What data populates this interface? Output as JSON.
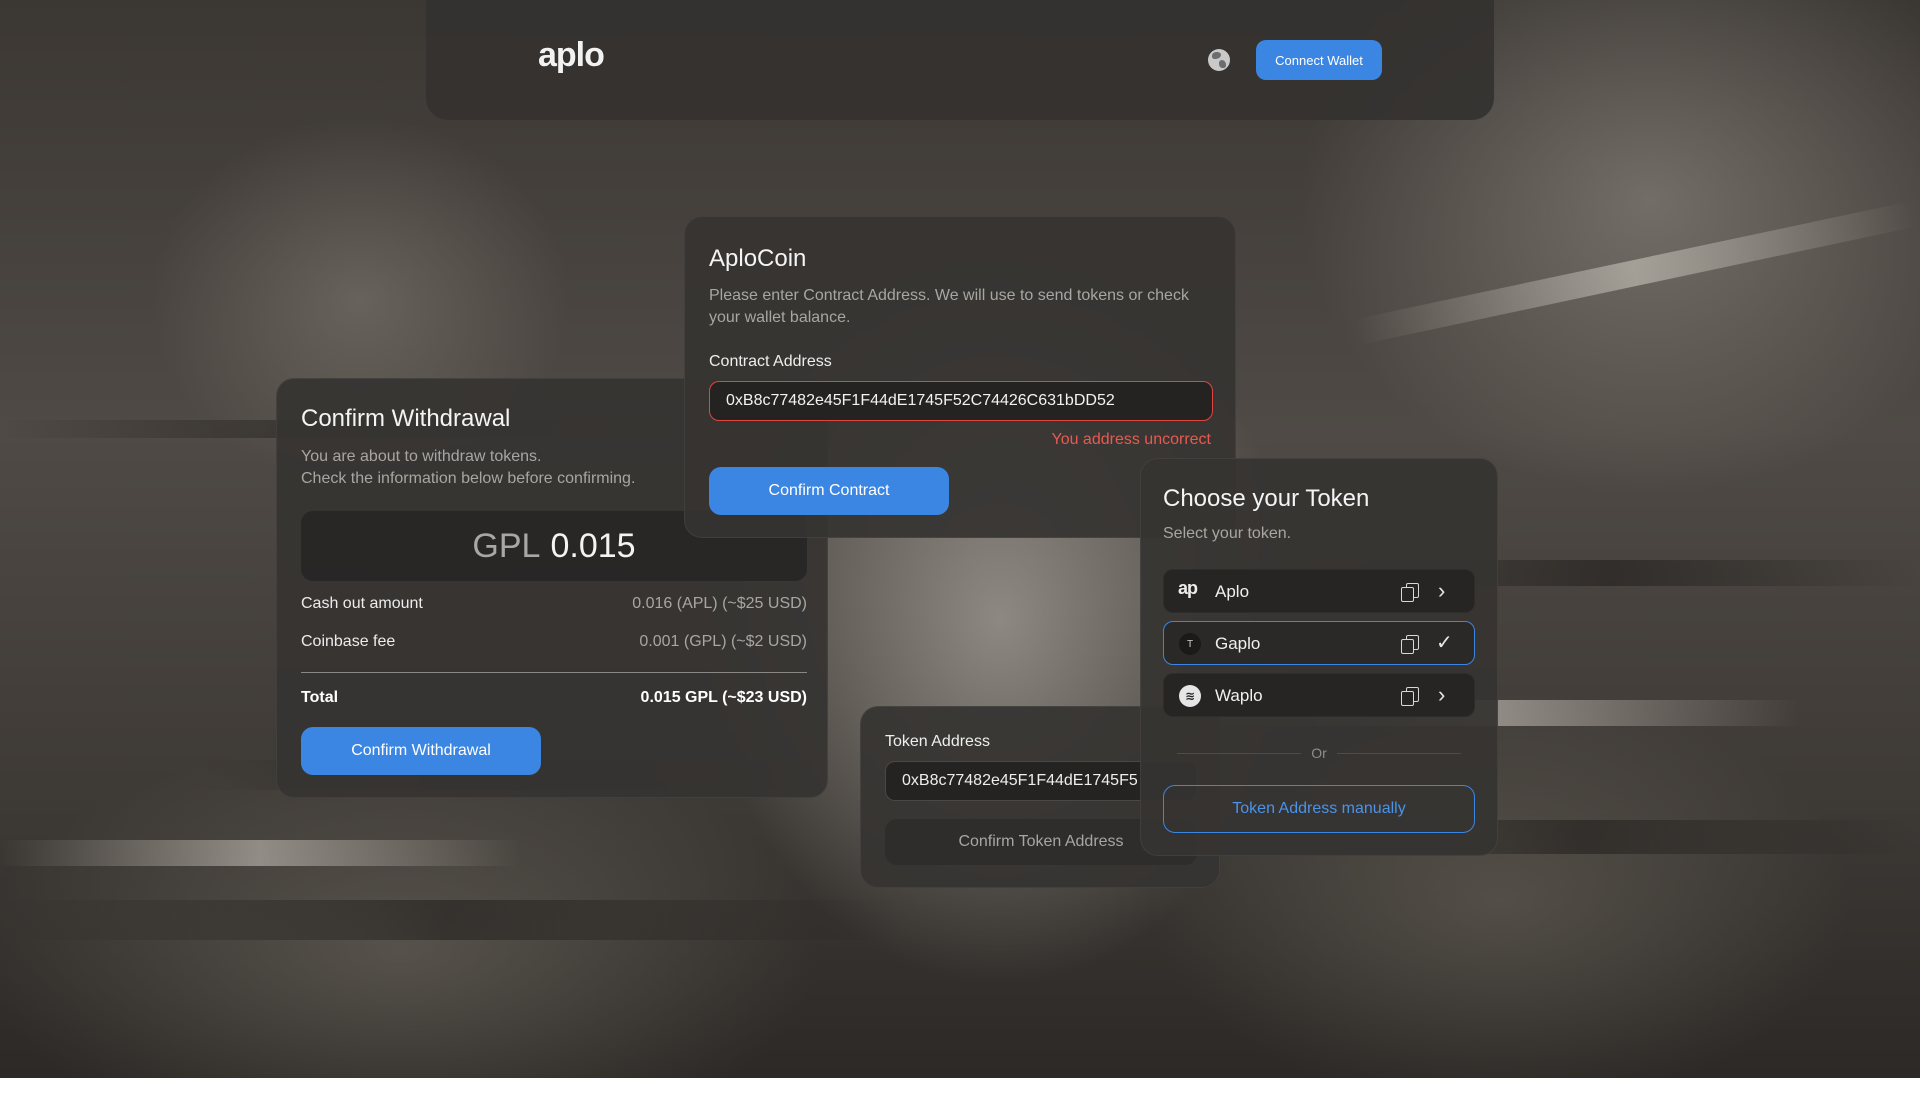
{
  "header": {
    "logo": "aplo",
    "connect_label": "Connect Wallet"
  },
  "withdrawal": {
    "title": "Confirm Withdrawal",
    "subtitle_line1": "You are about to withdraw tokens.",
    "subtitle_line2": "Check the information below before confirming.",
    "amount_currency": "GPL",
    "amount_value": "0.015",
    "rows": [
      {
        "label": "Cash out amount",
        "value": "0.016 (APL) (~$25 USD)"
      },
      {
        "label": "Coinbase fee",
        "value": "0.001 (GPL) (~$2 USD)"
      }
    ],
    "total_label": "Total",
    "total_value": "0.015 GPL (~$23 USD)",
    "confirm_label": "Confirm Withdrawal"
  },
  "aplocoin": {
    "title": "AploCoin",
    "subtitle": "Please enter Contract Address. We will use to send tokens or check your wallet balance.",
    "field_label": "Contract Address",
    "field_value": "0xB8c77482e45F1F44dE1745F52C74426C631bDD52",
    "error": "You address uncorrect",
    "confirm_label": "Confirm Contract"
  },
  "token_address": {
    "label": "Token Address",
    "value": "0xB8c77482e45F1F44dE1745F5",
    "confirm_label": "Confirm Token Address"
  },
  "choose_token": {
    "title": "Choose your Token",
    "subtitle": "Select your token.",
    "tokens": [
      {
        "name": "Aplo",
        "icon": "aplo-token-icon",
        "state": "chevron"
      },
      {
        "name": "Gaplo",
        "icon": "gaplo-token-icon",
        "state": "selected"
      },
      {
        "name": "Waplo",
        "icon": "waplo-token-icon",
        "state": "chevron"
      }
    ],
    "or_label": "Or",
    "manual_label": "Token Address manually"
  },
  "colors": {
    "accent": "#3b86e3",
    "error": "#e85a4f",
    "card": "#363432"
  }
}
